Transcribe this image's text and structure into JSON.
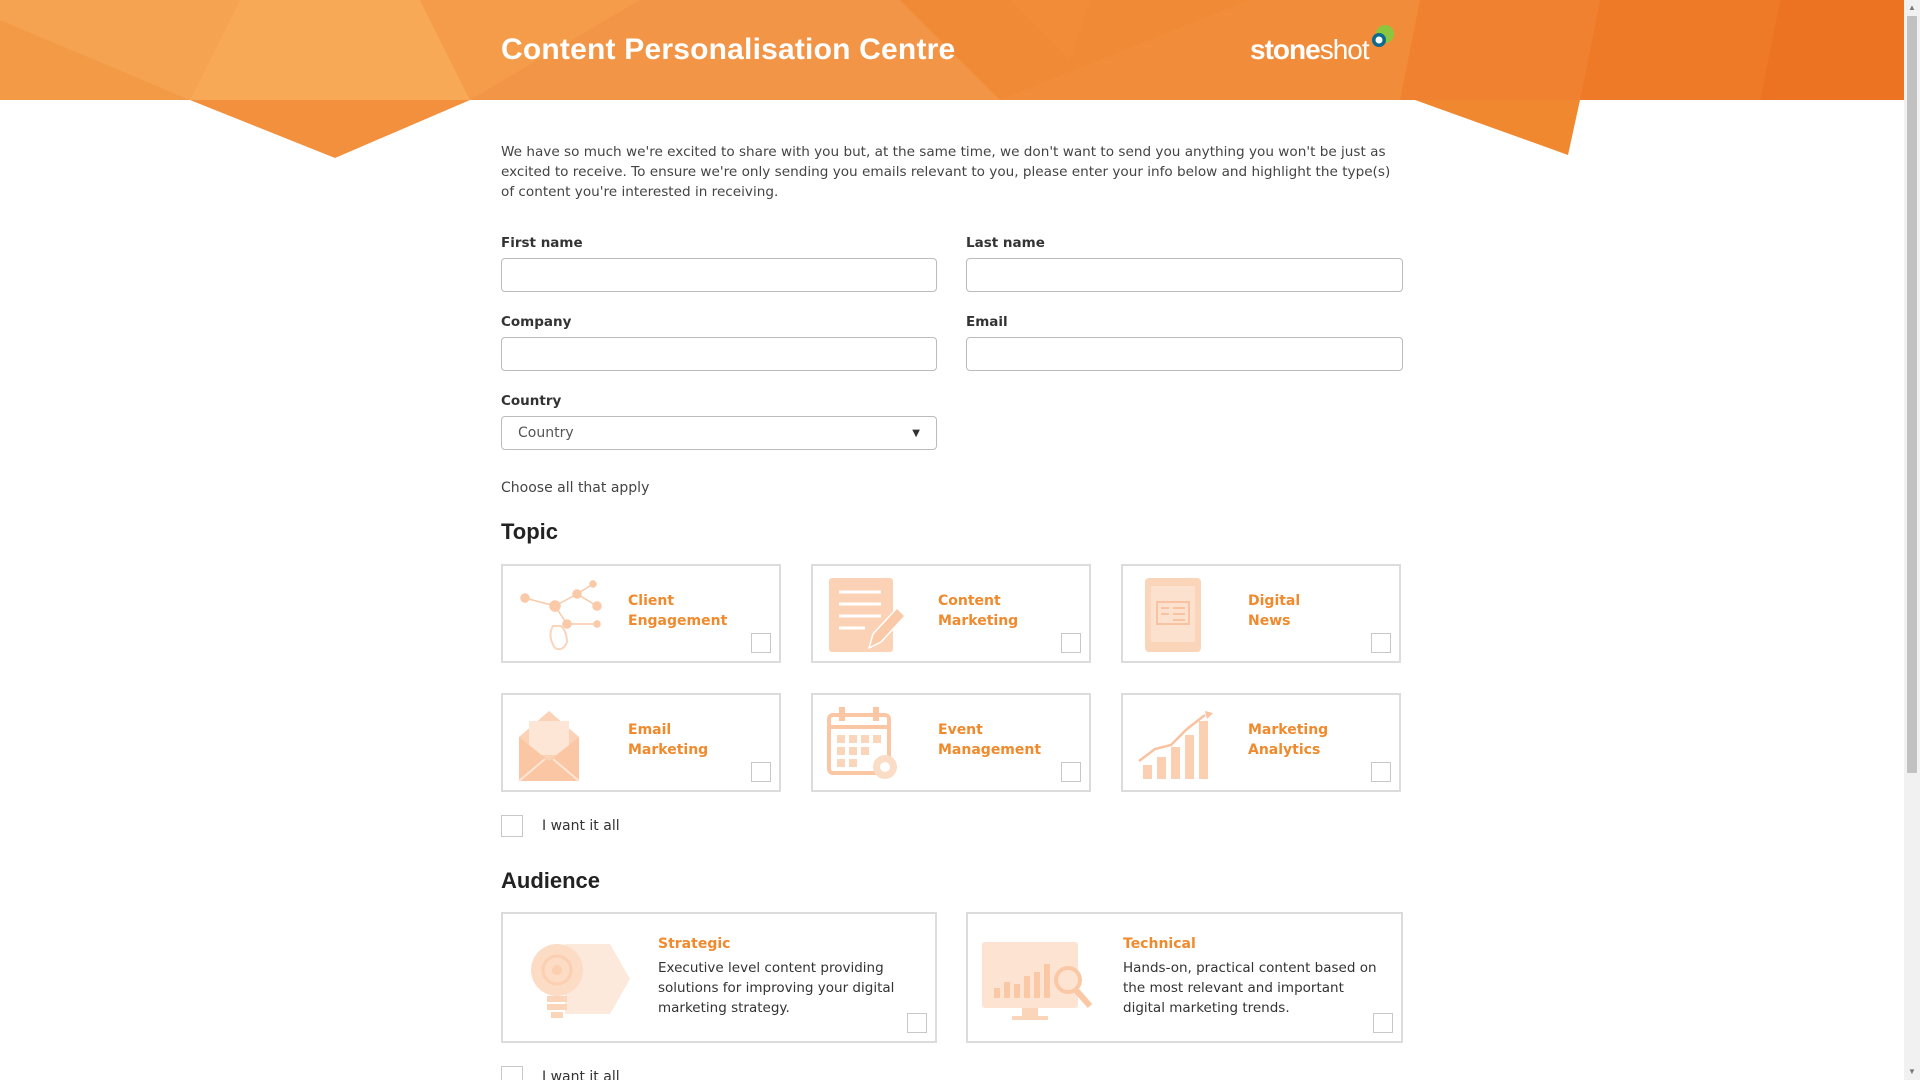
{
  "header": {
    "title": "Content Personalisation Centre",
    "logo_text_bold": "stone",
    "logo_text_light": "shot"
  },
  "intro": "We have so much we're excited to share with you but, at the same time, we don't want to send you anything you won't be just as excited to receive. To ensure we're only sending you emails relevant to you, please enter your info below and highlight the type(s) of content you're interested in receiving.",
  "form": {
    "first_name_label": "First name",
    "last_name_label": "Last name",
    "company_label": "Company",
    "email_label": "Email",
    "country_label": "Country",
    "country_selected": "Country",
    "first_name_value": "",
    "last_name_value": "",
    "company_value": "",
    "email_value": ""
  },
  "choose_hint": "Choose all that apply",
  "topic": {
    "title": "Topic",
    "cards": [
      {
        "line1": "Client",
        "line2": "Engagement",
        "icon": "network-icon"
      },
      {
        "line1": "Content",
        "line2": "Marketing",
        "icon": "document-pen-icon"
      },
      {
        "line1": "Digital",
        "line2": "News",
        "icon": "tablet-news-icon"
      },
      {
        "line1": "Email",
        "line2": "Marketing",
        "icon": "envelope-icon"
      },
      {
        "line1": "Event",
        "line2": "Management",
        "icon": "calendar-gear-icon"
      },
      {
        "line1": "Marketing",
        "line2": "Analytics",
        "icon": "bar-chart-icon"
      }
    ],
    "all_label": "I want it all"
  },
  "audience": {
    "title": "Audience",
    "cards": [
      {
        "title": "Strategic",
        "desc": "Executive level content providing solutions for improving your digital marketing strategy.",
        "icon": "lightbulb-icon"
      },
      {
        "title": "Technical",
        "desc": "Hands-on, practical content based on the most relevant and important digital marketing trends.",
        "icon": "monitor-chart-icon"
      }
    ],
    "all_label": "I want it all"
  },
  "colors": {
    "accent": "#f08a2c",
    "banner_light": "#f5a04a",
    "banner_dark": "#ee7a26"
  }
}
